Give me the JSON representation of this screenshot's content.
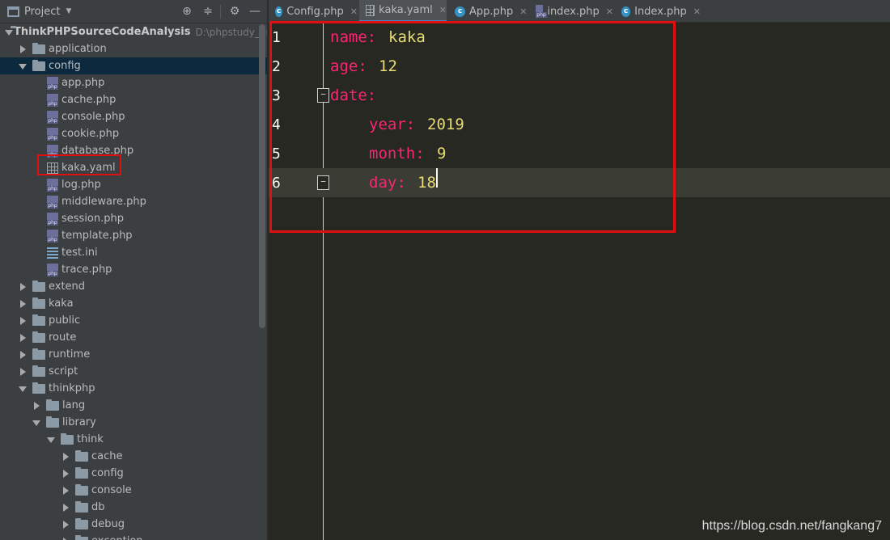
{
  "project_panel": {
    "title": "Project",
    "root": {
      "name": "ThinkPHPSourceCodeAnalysis",
      "path": "D:\\phpstudy_pro"
    },
    "items": [
      {
        "label": "application"
      },
      {
        "label": "config"
      },
      {
        "label": "app.php"
      },
      {
        "label": "cache.php"
      },
      {
        "label": "console.php"
      },
      {
        "label": "cookie.php"
      },
      {
        "label": "database.php"
      },
      {
        "label": "kaka.yaml"
      },
      {
        "label": "log.php"
      },
      {
        "label": "middleware.php"
      },
      {
        "label": "session.php"
      },
      {
        "label": "template.php"
      },
      {
        "label": "test.ini"
      },
      {
        "label": "trace.php"
      },
      {
        "label": "extend"
      },
      {
        "label": "kaka"
      },
      {
        "label": "public"
      },
      {
        "label": "route"
      },
      {
        "label": "runtime"
      },
      {
        "label": "script"
      },
      {
        "label": "thinkphp"
      },
      {
        "label": "lang"
      },
      {
        "label": "library"
      },
      {
        "label": "think"
      },
      {
        "label": "cache"
      },
      {
        "label": "config"
      },
      {
        "label": "console"
      },
      {
        "label": "db"
      },
      {
        "label": "debug"
      },
      {
        "label": "exception"
      }
    ]
  },
  "tabs": [
    {
      "label": "Config.php",
      "icon": "c-class-icon"
    },
    {
      "label": "kaka.yaml",
      "icon": "yaml-icon"
    },
    {
      "label": "App.php",
      "icon": "c-class-icon"
    },
    {
      "label": "index.php",
      "icon": "php-file-icon"
    },
    {
      "label": "Index.php",
      "icon": "c-class-icon"
    }
  ],
  "code": {
    "lines": [
      {
        "n": "1",
        "key": "name:",
        "value": "kaka"
      },
      {
        "n": "2",
        "key": "age:",
        "value": "12"
      },
      {
        "n": "3",
        "key": "date:",
        "value": ""
      },
      {
        "n": "4",
        "key": "year:",
        "value": "2019"
      },
      {
        "n": "5",
        "key": "month:",
        "value": "9"
      },
      {
        "n": "6",
        "key": "day:",
        "value": "18"
      }
    ]
  },
  "watermark": "https://blog.csdn.net/fangkang7",
  "colors": {
    "key": "#f92672",
    "value": "#e6db74",
    "highlight_box": "#e01010",
    "selection": "#0d293e"
  }
}
